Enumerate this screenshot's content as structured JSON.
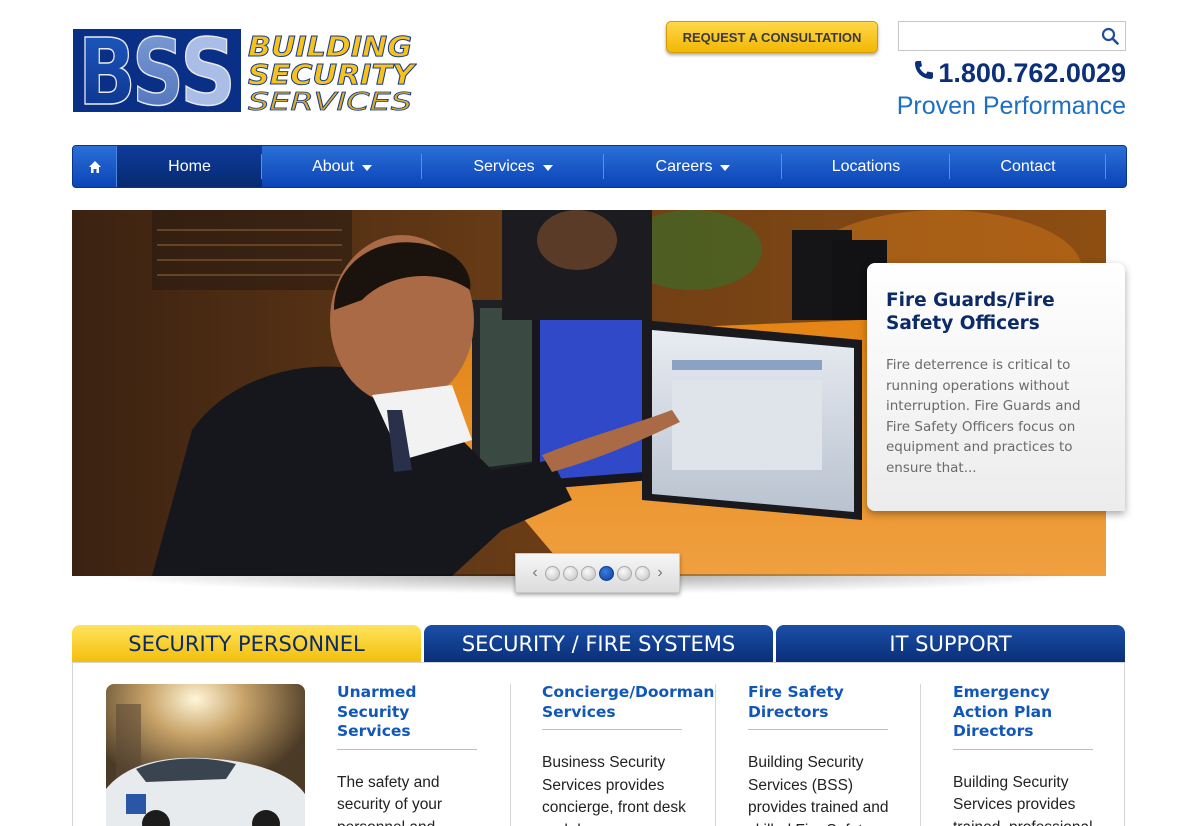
{
  "header": {
    "logo": {
      "initials": "BSS",
      "line1": "BUILDING",
      "line2": "SECURITY",
      "line3": "SERVICES"
    },
    "consult_button": "REQUEST A CONSULTATION",
    "search_placeholder": "",
    "phone": "1.800.762.0029",
    "tagline": "Proven Performance"
  },
  "nav": {
    "items": [
      {
        "label": "Home",
        "dropdown": false,
        "active": true
      },
      {
        "label": "About",
        "dropdown": true
      },
      {
        "label": "Services",
        "dropdown": true
      },
      {
        "label": "Careers",
        "dropdown": true
      },
      {
        "label": "Locations",
        "dropdown": false
      },
      {
        "label": "Contact",
        "dropdown": false
      }
    ]
  },
  "hero": {
    "card_title": "Fire Guards/Fire Safety Officers",
    "card_text": "Fire deterrence is critical to running operations without interruption. Fire Guards and Fire Safety Officers focus on equipment and practices to ensure that...",
    "slide_count": 6,
    "active_slide": 4
  },
  "tabs": [
    {
      "label": "SECURITY PERSONNEL",
      "active": true
    },
    {
      "label": "SECURITY / FIRE SYSTEMS",
      "active": false
    },
    {
      "label": "IT SUPPORT",
      "active": false
    }
  ],
  "services": [
    {
      "title": "Unarmed Security Services",
      "text": "The safety and security of your personnel and property directly"
    },
    {
      "title": "Concierge/Doorman Services",
      "text": "Business Security Services provides concierge, front desk and doorman"
    },
    {
      "title": "Fire Safety Directors",
      "text": "Building Security Services (BSS) provides trained and skilled Fire Safety"
    },
    {
      "title": "Emergency Action Plan Directors",
      "text": "Building Security Services provides trained, professional Emergency Action"
    }
  ],
  "colors": {
    "brand_blue": "#0b2f7a",
    "accent_yellow": "#f3bf0c",
    "link_blue": "#1057b8",
    "tagline_blue": "#1d6fc4"
  }
}
